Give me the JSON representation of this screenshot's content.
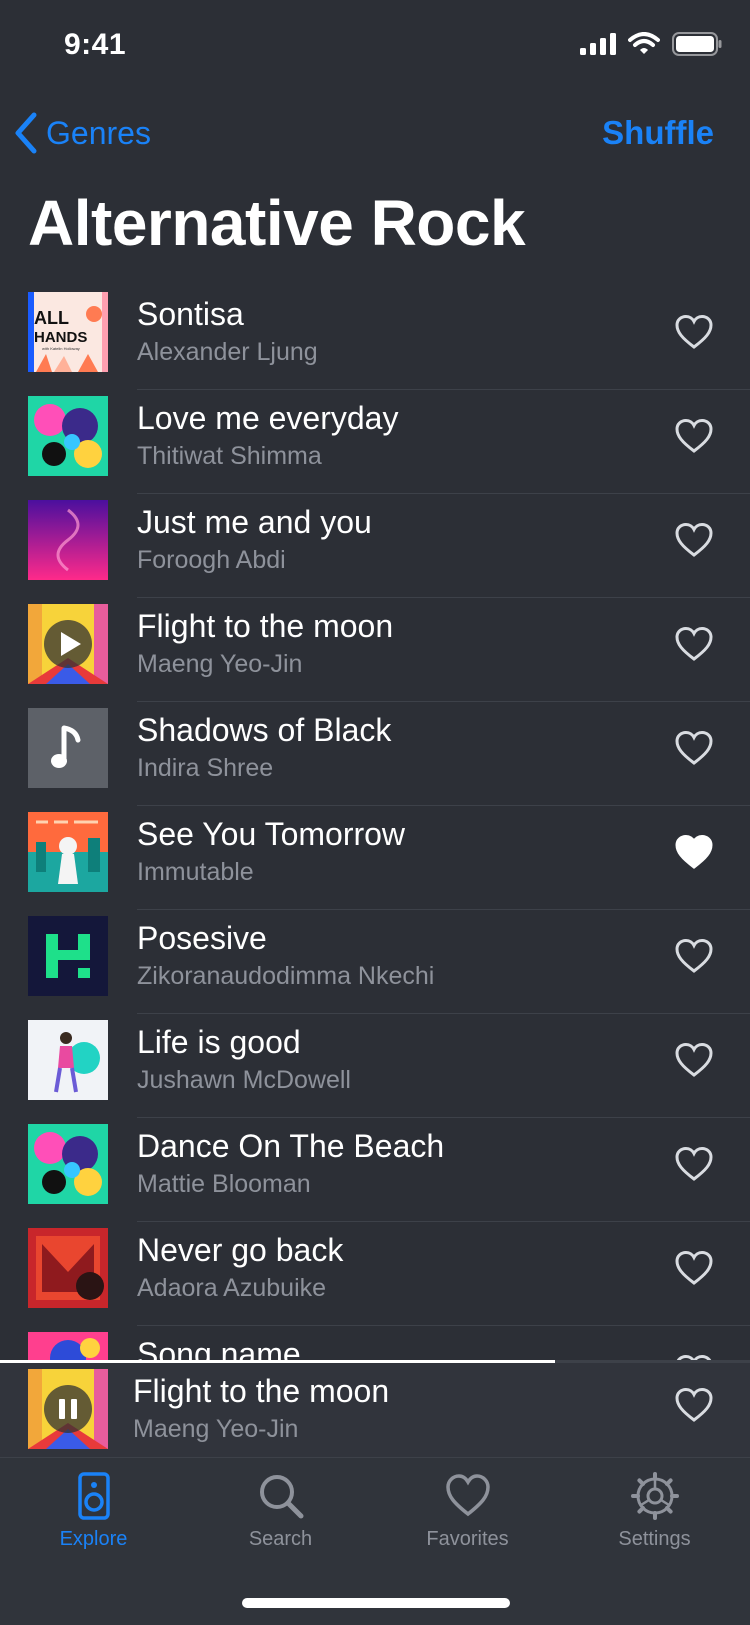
{
  "status": {
    "time": "9:41"
  },
  "nav": {
    "back_label": "Genres",
    "action_label": "Shuffle"
  },
  "page": {
    "title": "Alternative Rock"
  },
  "songs": [
    {
      "title": "Sontisa",
      "artist": "Alexander Ljung",
      "favorite": false
    },
    {
      "title": "Love me everyday",
      "artist": "Thitiwat Shimma",
      "favorite": false
    },
    {
      "title": "Just me and you",
      "artist": "Foroogh Abdi",
      "favorite": false
    },
    {
      "title": "Flight to the moon",
      "artist": "Maeng Yeo-Jin",
      "favorite": false
    },
    {
      "title": "Shadows of Black",
      "artist": "Indira Shree",
      "favorite": false
    },
    {
      "title": "See You Tomorrow",
      "artist": "Immutable",
      "favorite": true
    },
    {
      "title": "Posesive",
      "artist": "Zikoranaudodimma Nkechi",
      "favorite": false
    },
    {
      "title": "Life is good",
      "artist": "Jushawn McDowell",
      "favorite": false
    },
    {
      "title": "Dance On The Beach",
      "artist": "Mattie Blooman",
      "favorite": false
    },
    {
      "title": "Never go back",
      "artist": "Adaora Azubuike",
      "favorite": false
    },
    {
      "title": "Song name",
      "artist": "",
      "favorite": false
    }
  ],
  "album_art_text": {
    "all_hands_line1": "ALL",
    "all_hands_line2": "HANDS",
    "all_hands_sub": "with Katelin Holloway"
  },
  "now_playing": {
    "title": "Flight to the moon",
    "artist": "Maeng Yeo-Jin",
    "progress": 0.74,
    "state": "playing",
    "favorite": false
  },
  "tabs": [
    {
      "label": "Explore",
      "icon": "speaker-icon",
      "active": true
    },
    {
      "label": "Search",
      "icon": "search-icon",
      "active": false
    },
    {
      "label": "Favorites",
      "icon": "heart-icon",
      "active": false
    },
    {
      "label": "Settings",
      "icon": "gear-icon",
      "active": false
    }
  ],
  "colors": {
    "accent": "#1a82f7",
    "background": "#2c2f36",
    "secondary_text": "#8e929b"
  }
}
